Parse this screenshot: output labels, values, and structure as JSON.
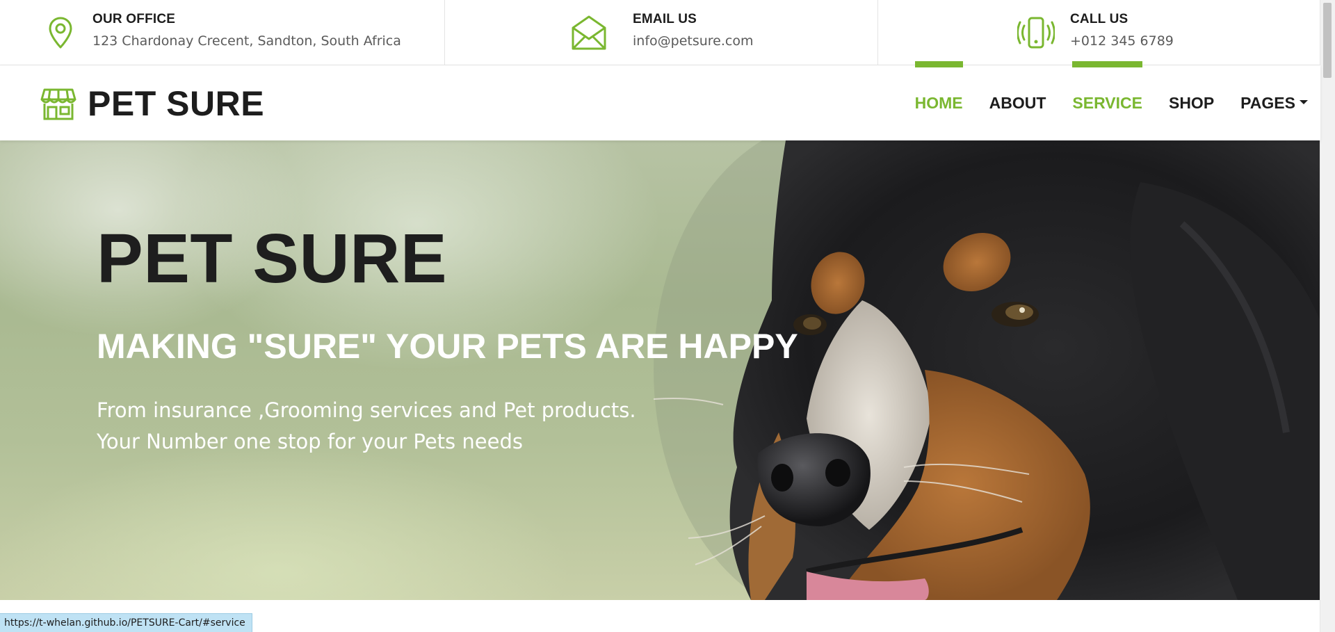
{
  "colors": {
    "accent": "#7ab730",
    "dark_text": "#1d1d1d",
    "muted_text": "#5a5a5a",
    "status_bg": "#bfe2f4"
  },
  "topbar": {
    "office": {
      "icon": "map-pin-icon",
      "title": "OUR OFFICE",
      "value": "123 Chardonay Crecent, Sandton, South Africa"
    },
    "email": {
      "icon": "envelope-icon",
      "title": "EMAIL US",
      "value": "info@petsure.com"
    },
    "call": {
      "icon": "vibrating-phone-icon",
      "title": "CALL US",
      "value": "+012 345 6789"
    }
  },
  "navbar": {
    "brand_icon": "storefront-icon",
    "brand_name": "PET SURE",
    "items": [
      {
        "label": "HOME",
        "active": true
      },
      {
        "label": "ABOUT",
        "active": false
      },
      {
        "label": "SERVICE",
        "active": true
      },
      {
        "label": "SHOP",
        "active": false
      },
      {
        "label": "PAGES",
        "active": false,
        "dropdown": true
      }
    ]
  },
  "hero": {
    "title": "PET SURE",
    "subtitle": "MAKING \"SURE\" YOUR PETS ARE HAPPY",
    "desc_line1": "From insurance ,Grooming services and Pet products.",
    "desc_line2": "Your Number one stop for your Pets needs",
    "image": "dog-close-up-photo"
  },
  "status_bar": {
    "url": "https://t-whelan.github.io/PETSURE-Cart/#service"
  }
}
